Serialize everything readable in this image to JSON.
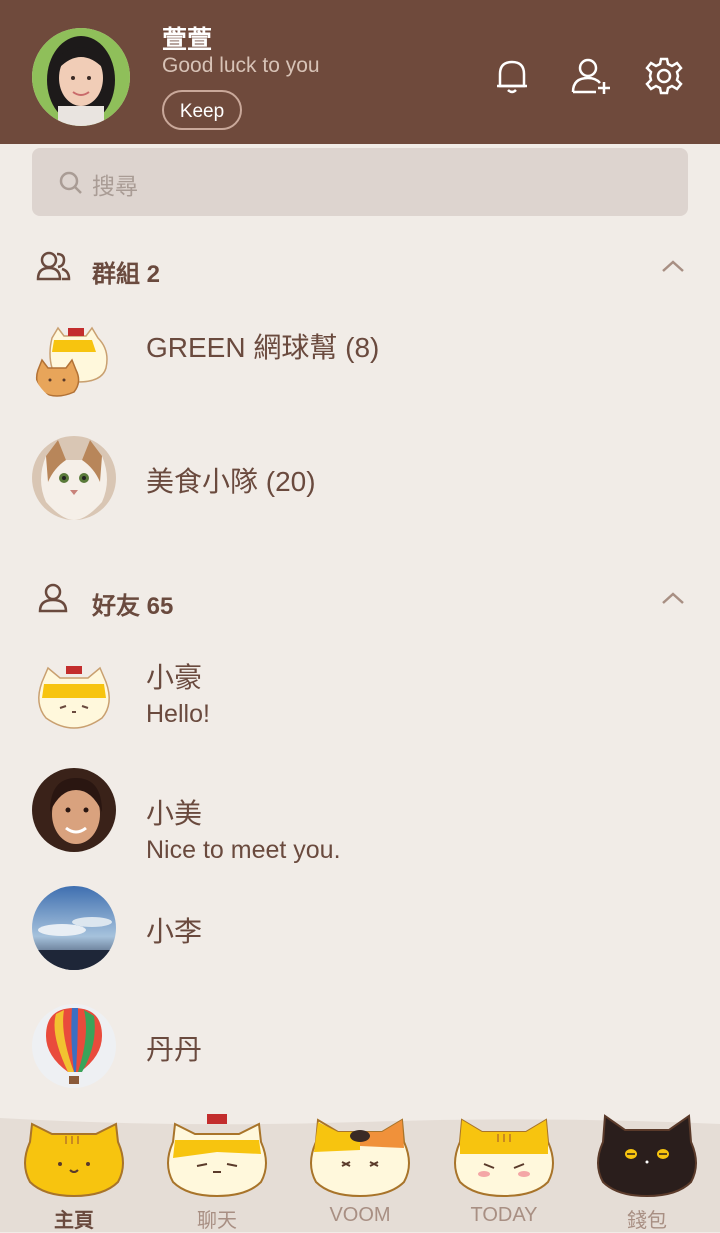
{
  "profile": {
    "name": "萱萱",
    "status": "Good luck to you",
    "keep_label": "Keep"
  },
  "header_icons": [
    "bell-icon",
    "add-friend-icon",
    "gear-icon"
  ],
  "search": {
    "placeholder": "搜尋"
  },
  "groups": {
    "title": "群組 2",
    "items": [
      {
        "name": "GREEN 網球幫 (8)"
      },
      {
        "name": "美食小隊 (20)"
      }
    ]
  },
  "friends": {
    "title": "好友 65",
    "items": [
      {
        "name": "小豪",
        "status": "Hello!"
      },
      {
        "name": "小美",
        "status": "Nice to meet you."
      },
      {
        "name": "小李"
      },
      {
        "name": "丹丹"
      }
    ]
  },
  "tabs": [
    {
      "label": "主頁",
      "active": true
    },
    {
      "label": "聊天"
    },
    {
      "label": "VOOM"
    },
    {
      "label": "TODAY"
    },
    {
      "label": "錢包"
    }
  ],
  "colors": {
    "header": "#6f4a3c",
    "background": "#f1ece7",
    "text": "#6a4a3e",
    "search_bg": "#ddd4cf",
    "cat_yellow": "#f7c40f"
  }
}
